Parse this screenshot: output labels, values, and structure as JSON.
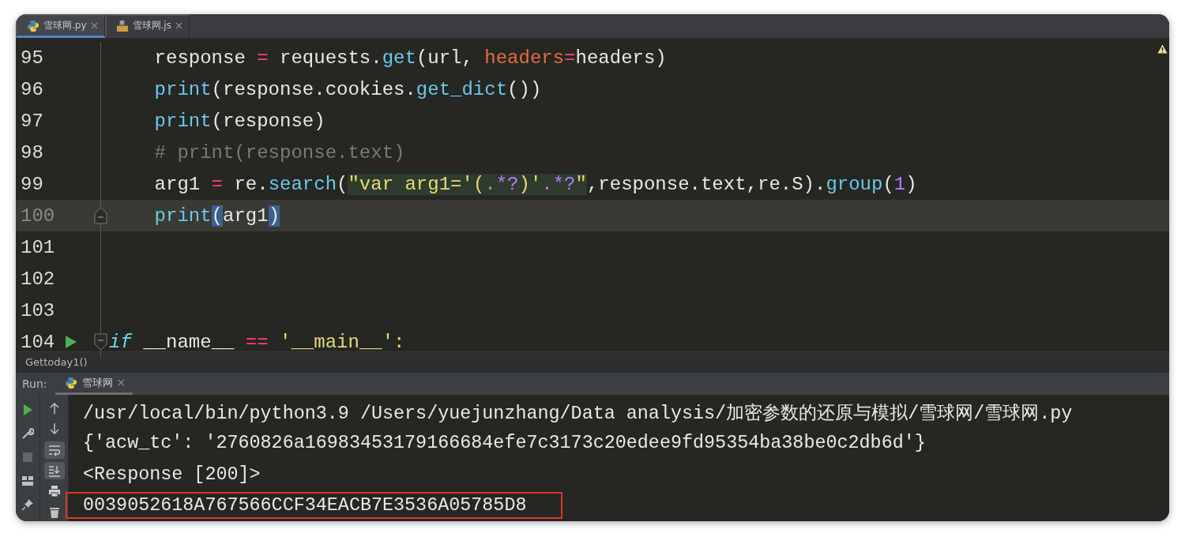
{
  "tabs": [
    {
      "label": "雪球网.py",
      "kind": "python",
      "selected": true
    },
    {
      "label": "雪球网.js",
      "kind": "js",
      "selected": false
    }
  ],
  "editor": {
    "warning": true,
    "lines": [
      {
        "number": "95",
        "current": false,
        "kind": "plain",
        "indented": true,
        "tokens": [
          {
            "kind": "plain",
            "text": "response "
          },
          {
            "kind": "op",
            "text": "="
          },
          {
            "kind": "plain",
            "text": " requests."
          },
          {
            "kind": "func",
            "text": "get"
          },
          {
            "kind": "plain",
            "text": "(url, "
          },
          {
            "kind": "param",
            "text": "headers"
          },
          {
            "kind": "op",
            "text": "="
          },
          {
            "kind": "plain",
            "text": "headers)"
          }
        ]
      },
      {
        "number": "96",
        "current": false,
        "kind": "plain",
        "indented": true,
        "tokens": [
          {
            "kind": "func",
            "text": "print"
          },
          {
            "kind": "plain",
            "text": "(response.cookies."
          },
          {
            "kind": "func",
            "text": "get_dict"
          },
          {
            "kind": "plain",
            "text": "())"
          }
        ]
      },
      {
        "number": "97",
        "current": false,
        "kind": "plain",
        "indented": true,
        "tokens": [
          {
            "kind": "func",
            "text": "print"
          },
          {
            "kind": "plain",
            "text": "(response)"
          }
        ]
      },
      {
        "number": "98",
        "current": false,
        "kind": "plain",
        "indented": true,
        "tokens": [
          {
            "kind": "comment",
            "text": "# print(response.text)"
          }
        ]
      },
      {
        "number": "99",
        "current": false,
        "kind": "plain",
        "indented": true,
        "tokens": [
          {
            "kind": "plain",
            "text": "arg1 "
          },
          {
            "kind": "op",
            "text": "="
          },
          {
            "kind": "plain",
            "text": " re."
          },
          {
            "kind": "func",
            "text": "search"
          },
          {
            "kind": "plain",
            "text": "("
          },
          {
            "kind": "inj-string",
            "text": "\"var arg1='("
          },
          {
            "kind": "inj-regex",
            "text": ".*?"
          },
          {
            "kind": "inj-string",
            "text": ")'"
          },
          {
            "kind": "inj-regex",
            "text": ".*?"
          },
          {
            "kind": "inj-string",
            "text": "\""
          },
          {
            "kind": "plain",
            "text": ",response.text,re.S)."
          },
          {
            "kind": "func",
            "text": "group"
          },
          {
            "kind": "plain",
            "text": "("
          },
          {
            "kind": "number",
            "text": "1"
          },
          {
            "kind": "plain",
            "text": ")"
          }
        ]
      },
      {
        "number": "100",
        "current": true,
        "kind": "fold-end",
        "indented": true,
        "tokens": [
          {
            "kind": "func",
            "text": "print"
          },
          {
            "kind": "bracket",
            "text": "("
          },
          {
            "kind": "plain",
            "text": "arg1"
          },
          {
            "kind": "bracket",
            "text": ")"
          }
        ]
      },
      {
        "number": "101",
        "current": false,
        "kind": "plain"
      },
      {
        "number": "102",
        "current": false,
        "kind": "plain"
      },
      {
        "number": "103",
        "current": false,
        "kind": "plain"
      },
      {
        "number": "104",
        "current": false,
        "kind": "run-fold-start",
        "indented": false,
        "tokens": [
          {
            "kind": "keyword",
            "text": "if"
          },
          {
            "kind": "plain",
            "text": " __name__ "
          },
          {
            "kind": "op",
            "text": "=="
          },
          {
            "kind": "string",
            "text": " '__main__':"
          }
        ]
      }
    ]
  },
  "breadcrumb": "Gettoday1()",
  "run_panel": {
    "label": "Run:",
    "tab": "雪球网",
    "side_tools": [
      {
        "kind": "run",
        "disabled": false
      },
      {
        "kind": "wrench",
        "disabled": false
      },
      {
        "kind": "stop",
        "disabled": true
      },
      {
        "kind": "layout",
        "disabled": false
      },
      {
        "kind": "pin",
        "disabled": false
      }
    ],
    "console_tools": [
      {
        "kind": "up",
        "on": false
      },
      {
        "kind": "down",
        "on": false
      },
      {
        "kind": "wrap",
        "on": true
      },
      {
        "kind": "scroll-end",
        "on": true
      },
      {
        "kind": "print",
        "on": false
      },
      {
        "kind": "trash",
        "on": false
      }
    ],
    "output": [
      {
        "text": "/usr/local/bin/python3.9 /Users/yuejunzhang/Data analysis/加密参数的还原与模拟/雪球网/雪球网.py",
        "highlighted": false
      },
      {
        "text": "{'acw_tc': '2760826a16983453179166684efe7c3173c20edee9fd95354ba38be0c2db6d'}",
        "highlighted": false
      },
      {
        "text": "<Response [200]>",
        "highlighted": false
      },
      {
        "text": "0039052618A767566CCF34EACB7E3536A05785D8",
        "highlighted": true
      }
    ]
  }
}
